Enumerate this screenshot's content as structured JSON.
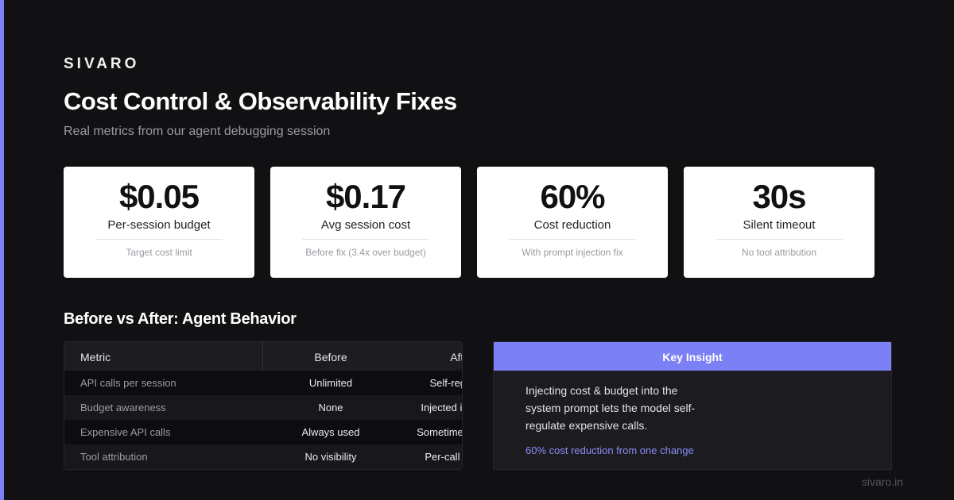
{
  "brand": "SIVARO",
  "title": "Cost Control & Observability Fixes",
  "subtitle": "Real metrics from our agent debugging session",
  "cards": [
    {
      "value": "$0.05",
      "label": "Per-session budget",
      "note": "Target cost limit"
    },
    {
      "value": "$0.17",
      "label": "Avg session cost",
      "note": "Before fix (3.4x over budget)"
    },
    {
      "value": "60%",
      "label": "Cost reduction",
      "note": "With prompt injection fix"
    },
    {
      "value": "30s",
      "label": "Silent timeout",
      "note": "No tool attribution"
    }
  ],
  "comparison": {
    "title": "Before vs After: Agent Behavior",
    "headers": {
      "metric": "Metric",
      "before": "Before",
      "after": "After"
    },
    "rows": [
      {
        "metric": "API calls per session",
        "before": "Unlimited",
        "after": "Self-regulated"
      },
      {
        "metric": "Budget awareness",
        "before": "None",
        "after": "Injected in prompt"
      },
      {
        "metric": "Expensive API calls",
        "before": "Always used",
        "after": "Sometimes skipped"
      },
      {
        "metric": "Tool attribution",
        "before": "No visibility",
        "after": "Per-call tracking"
      }
    ]
  },
  "insight": {
    "heading": "Key Insight",
    "body": "Injecting cost & budget into the system prompt lets the model self-regulate expensive calls.",
    "highlight": "60% cost reduction from one change"
  },
  "footer": "sivaro.in",
  "colors": {
    "accent": "#7c7ff5",
    "highlight_text": "#8a8cf7",
    "background": "#111113"
  }
}
